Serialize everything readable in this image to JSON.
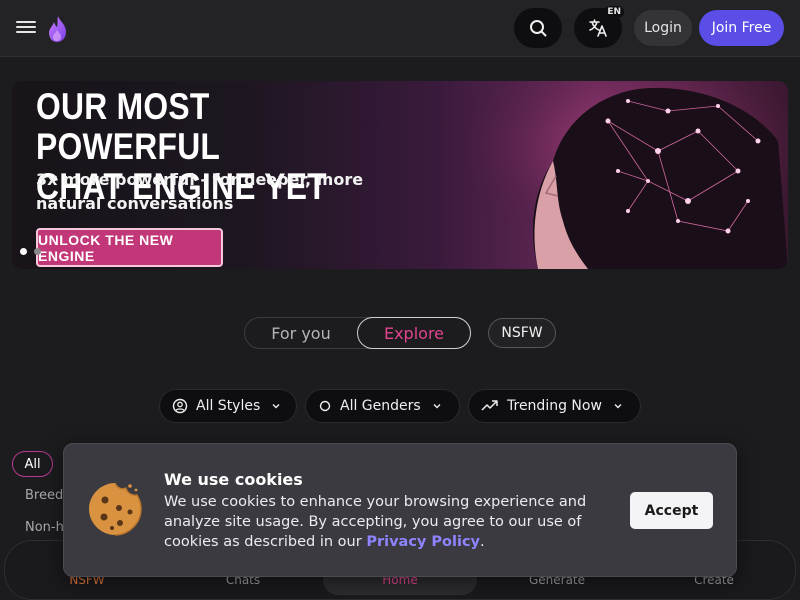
{
  "header": {
    "lang_badge": "EN",
    "login_label": "Login",
    "join_label": "Join Free",
    "icons": [
      "menu-icon",
      "flame-logo-icon",
      "search-icon",
      "translate-icon"
    ]
  },
  "banner": {
    "title": "OUR MOST POWERFUL\nCHAT ENGINE YET",
    "subtitle": "3x more powerful - for deeper, more natural conversations",
    "cta_label": "UNLOCK THE NEW ENGINE",
    "accent_color": "#c23778"
  },
  "tabs": {
    "for_you": "For you",
    "explore": "Explore",
    "nsfw": "NSFW",
    "active": "Explore"
  },
  "filters": {
    "styles": "All Styles",
    "genders": "All Genders",
    "sort": "Trending Now"
  },
  "categories": {
    "all": "All",
    "item1": "Breedi",
    "item2": "Non-hu"
  },
  "cookie": {
    "title": "We use cookies",
    "text_before": "We use cookies to enhance your browsing experience and analyze site usage. By accepting, you agree to our use of cookies as described in our ",
    "link": "Privacy Policy",
    "text_after": ".",
    "accept_label": "Accept"
  },
  "bottom_nav": {
    "nsfw": "NSFW",
    "chats": "Chats",
    "home": "Home",
    "generate": "Generate",
    "create": "Create",
    "active": "Home"
  },
  "colors": {
    "brand_purple": "#5a4ee6",
    "pink_accent": "#e2448e",
    "orange_accent": "#e4763a"
  }
}
